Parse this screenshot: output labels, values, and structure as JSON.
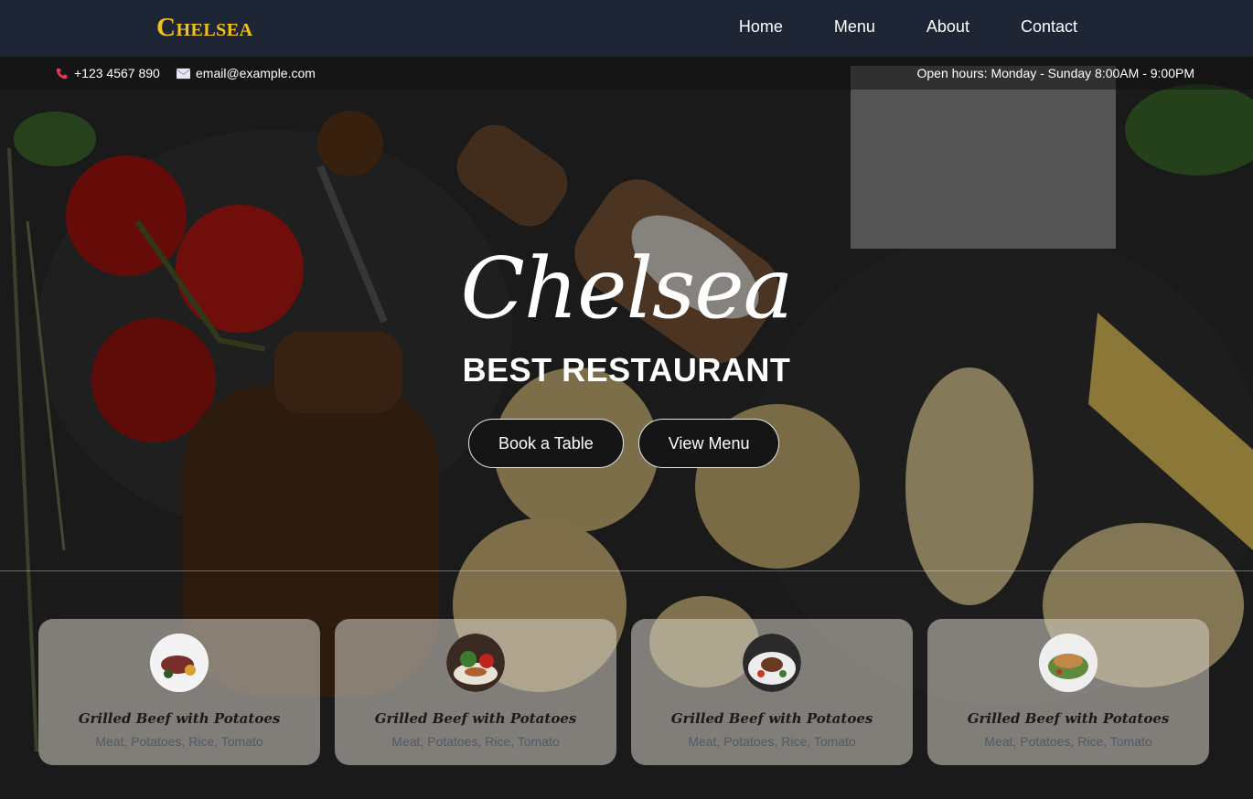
{
  "brand": {
    "logo": "Chelsea",
    "accent": "#f2c21b"
  },
  "nav": {
    "items": [
      "Home",
      "Menu",
      "About",
      "Contact"
    ]
  },
  "topbar": {
    "phone": "+123 4567 890",
    "email": "email@example.com",
    "hours": "Open hours: Monday - Sunday 8:00AM - 9:00PM",
    "phone_icon": "phone-icon",
    "email_icon": "envelope-icon"
  },
  "hero": {
    "script_title": "Chelsea",
    "subtitle": "BEST RESTAURANT",
    "book_button": "Book a Table",
    "menu_button": "View Menu"
  },
  "cards": [
    {
      "title": "Grilled Beef with Potatoes",
      "ingredients": "Meat, Potatoes, Rice, Tomato"
    },
    {
      "title": "Grilled Beef with Potatoes",
      "ingredients": "Meat, Potatoes, Rice, Tomato"
    },
    {
      "title": "Grilled Beef with Potatoes",
      "ingredients": "Meat, Potatoes, Rice, Tomato"
    },
    {
      "title": "Grilled Beef with Potatoes",
      "ingredients": "Meat, Potatoes, Rice, Tomato"
    }
  ]
}
